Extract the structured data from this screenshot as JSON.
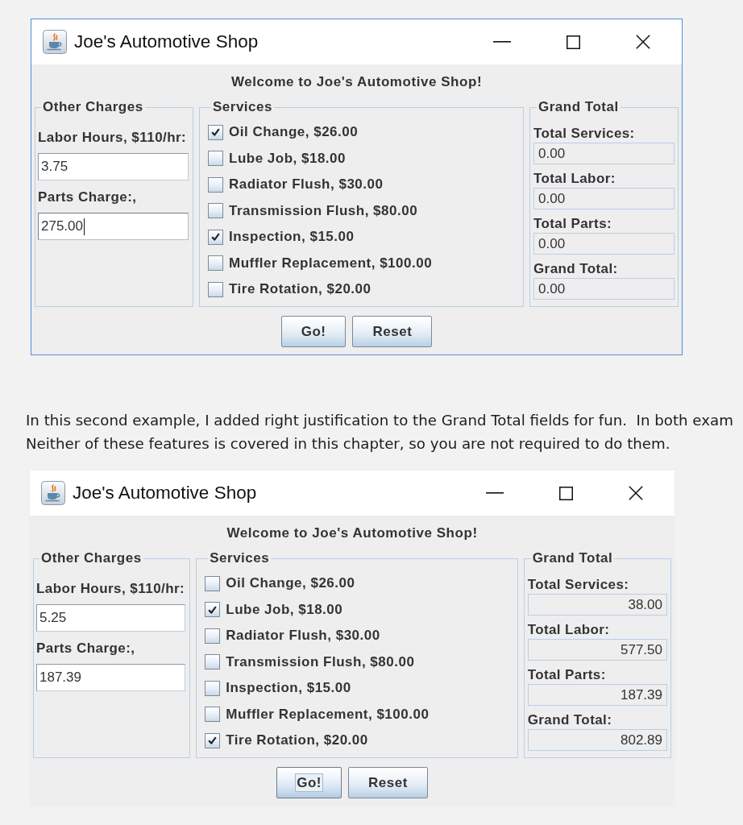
{
  "blocks": [
    {
      "kind": "window",
      "title": "Joe's Automotive Shop",
      "active": true,
      "welcome": "Welcome to Joe's Automotive Shop!",
      "other_charges": {
        "title": "Other Charges",
        "fields": [
          {
            "label": "Labor Hours, $110/hr:",
            "value": "3.75",
            "focused": false
          },
          {
            "label": "Parts Charge:,",
            "value": "275.00",
            "focused": true
          }
        ]
      },
      "services": {
        "title": "Services",
        "items": [
          {
            "label": "Oil Change, $26.00",
            "checked": true
          },
          {
            "label": "Lube Job, $18.00",
            "checked": false
          },
          {
            "label": "Radiator Flush, $30.00",
            "checked": false
          },
          {
            "label": "Transmission Flush, $80.00",
            "checked": false
          },
          {
            "label": "Inspection, $15.00",
            "checked": true
          },
          {
            "label": "Muffler Replacement, $100.00",
            "checked": false
          },
          {
            "label": "Tire Rotation, $20.00",
            "checked": false
          }
        ]
      },
      "grand_total": {
        "title": "Grand Total",
        "right_aligned": false,
        "items": [
          {
            "kind": "label",
            "text": "Total Services:"
          },
          {
            "kind": "field",
            "text": "0.00"
          },
          {
            "kind": "label",
            "text": "Total Labor:"
          },
          {
            "kind": "field",
            "text": "0.00"
          },
          {
            "kind": "label",
            "text": "Total Parts:"
          },
          {
            "kind": "field",
            "text": "0.00"
          },
          {
            "kind": "label",
            "text": "Grand Total:"
          },
          {
            "kind": "field",
            "text": "0.00"
          }
        ]
      },
      "buttons": [
        {
          "label": "Go!",
          "focused": false
        },
        {
          "label": "Reset",
          "focused": false
        }
      ]
    },
    {
      "kind": "paragraph",
      "text": "In this second example, I added right justification to the Grand Total fields for fun.  In both exam\nNeither of these features is covered in this chapter, so you are not required to do them."
    },
    {
      "kind": "window",
      "title": "Joe's Automotive Shop",
      "active": false,
      "welcome": "Welcome to Joe's Automotive Shop!",
      "other_charges": {
        "title": "Other Charges",
        "fields": [
          {
            "label": "Labor Hours, $110/hr:",
            "value": "5.25",
            "focused": false
          },
          {
            "label": "Parts Charge:,",
            "value": "187.39",
            "focused": false
          }
        ]
      },
      "services": {
        "title": "Services",
        "items": [
          {
            "label": "Oil Change, $26.00",
            "checked": false
          },
          {
            "label": "Lube Job, $18.00",
            "checked": true
          },
          {
            "label": "Radiator Flush, $30.00",
            "checked": false
          },
          {
            "label": "Transmission Flush, $80.00",
            "checked": false
          },
          {
            "label": "Inspection, $15.00",
            "checked": false
          },
          {
            "label": "Muffler Replacement, $100.00",
            "checked": false
          },
          {
            "label": "Tire Rotation, $20.00",
            "checked": true
          }
        ]
      },
      "grand_total": {
        "title": "Grand Total",
        "right_aligned": true,
        "items": [
          {
            "kind": "label",
            "text": "Total Services:"
          },
          {
            "kind": "field",
            "text": "38.00"
          },
          {
            "kind": "label",
            "text": "Total Labor:"
          },
          {
            "kind": "field",
            "text": "577.50"
          },
          {
            "kind": "label",
            "text": "Total Parts:"
          },
          {
            "kind": "field",
            "text": "187.39"
          },
          {
            "kind": "label",
            "text": "Grand Total:"
          },
          {
            "kind": "field",
            "text": "802.89"
          }
        ]
      },
      "buttons": [
        {
          "label": "Go!",
          "focused": true
        },
        {
          "label": "Reset",
          "focused": false
        }
      ]
    }
  ]
}
